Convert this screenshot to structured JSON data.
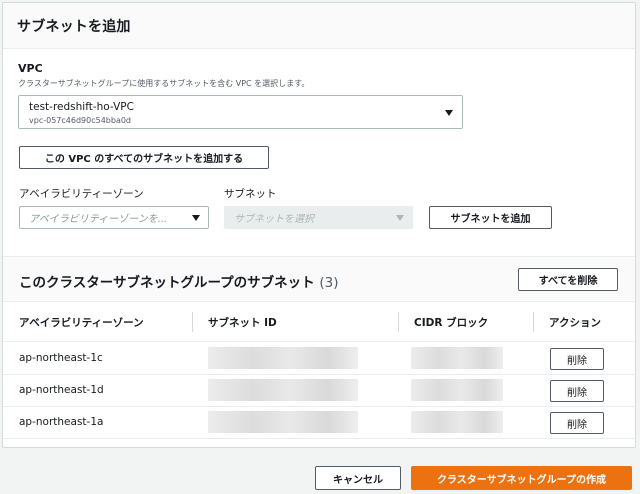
{
  "panel": {
    "title": "サブネットを追加"
  },
  "vpc": {
    "label": "VPC",
    "description": "クラスターサブネットグループに使用するサブネットを含む VPC を選択します。",
    "selected_name": "test-redshift-ho-VPC",
    "selected_id": "vpc-057c46d90c54bba0d",
    "add_all_button": "この VPC のすべてのサブネットを追加する"
  },
  "subnet_picker": {
    "az_label": "アベイラビリティーゾーン",
    "az_placeholder": "アベイラビリティーゾーンを...",
    "subnet_label": "サブネット",
    "subnet_placeholder": "サブネットを選択",
    "add_button": "サブネットを追加"
  },
  "group_subnets": {
    "title": "このクラスターサブネットグループのサブネット",
    "count": "(3)",
    "remove_all_button": "すべてを削除",
    "columns": [
      "アベイラビリティーゾーン",
      "サブネット ID",
      "CIDR ブロック",
      "アクション"
    ],
    "rows": [
      {
        "az": "ap-northeast-1c",
        "action": "削除"
      },
      {
        "az": "ap-northeast-1d",
        "action": "削除"
      },
      {
        "az": "ap-northeast-1a",
        "action": "削除"
      }
    ]
  },
  "footer": {
    "cancel_button": "キャンセル",
    "create_button": "クラスターサブネットグループの作成"
  },
  "colors": {
    "primary": "#ec7211",
    "border": "#aab7b8",
    "text": "#16191f"
  }
}
